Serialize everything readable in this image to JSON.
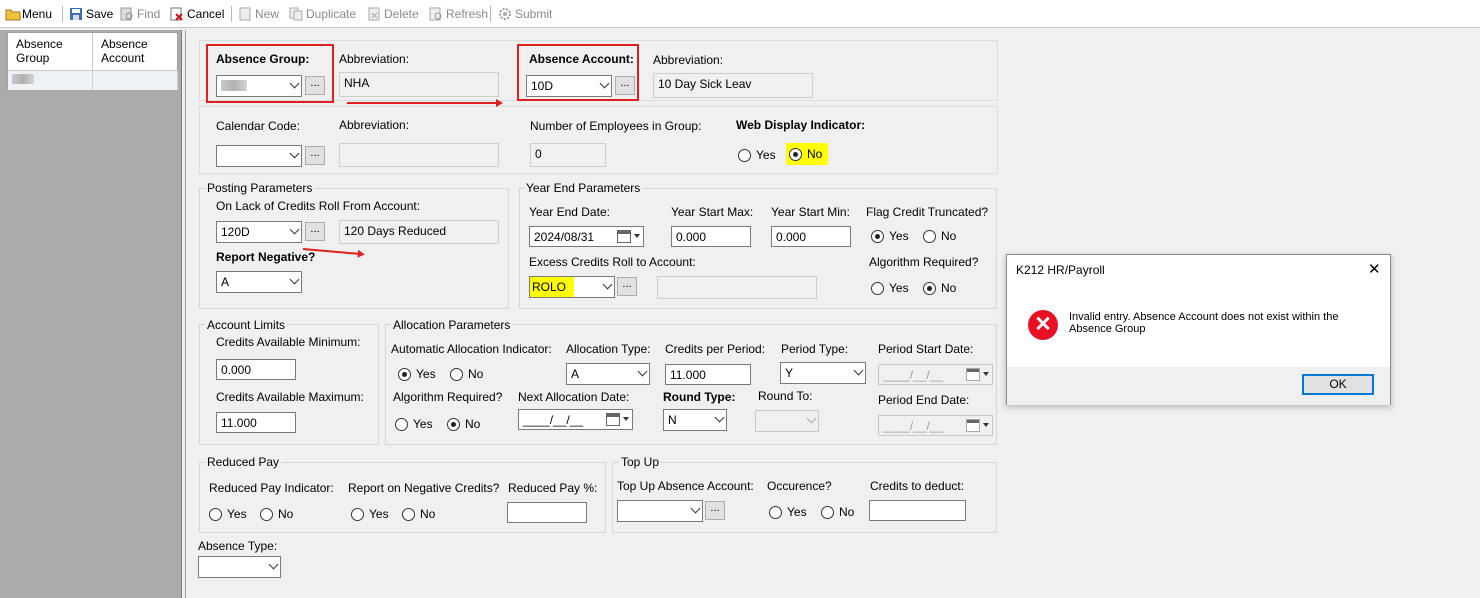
{
  "toolbar": {
    "menu": "Menu",
    "save": "Save",
    "find": "Find",
    "cancel": "Cancel",
    "new": "New",
    "duplicate": "Duplicate",
    "delete": "Delete",
    "refresh": "Refresh",
    "submit": "Submit"
  },
  "grid": {
    "col1": "Absence Group",
    "col2": "Absence Account"
  },
  "form": {
    "absence_group": {
      "label": "Absence Group:",
      "ellipsis": "..."
    },
    "abbrev1": {
      "label": "Abbreviation:",
      "value": "NHA"
    },
    "absence_account": {
      "label": "Absence Account:",
      "value": "10D",
      "ellipsis": "..."
    },
    "abbrev2": {
      "label": "Abbreviation:",
      "value": "10 Day Sick Leav"
    },
    "calendar_code": {
      "label": "Calendar Code:",
      "ellipsis": "..."
    },
    "abbrev3": {
      "label": "Abbreviation:"
    },
    "num_employees": {
      "label": "Number of Employees in Group:",
      "value": "0"
    },
    "web_display": {
      "label": "Web Display Indicator:",
      "yes": "Yes",
      "no": "No",
      "selected": "No"
    },
    "posting": {
      "title": "Posting Parameters",
      "roll_label": "On Lack of Credits Roll From Account:",
      "roll_value": "120D",
      "ellipsis": "...",
      "roll_desc": "120 Days Reduced",
      "report_negative_label": "Report Negative?",
      "report_negative_value": "A"
    },
    "year_end": {
      "title": "Year End Parameters",
      "date_label": "Year End Date:",
      "date_value": "2024/08/31",
      "start_max_label": "Year Start Max:",
      "start_max_value": "0.000",
      "start_min_label": "Year Start Min:",
      "start_min_value": "0.000",
      "flag_label": "Flag Credit Truncated?",
      "flag_yes": "Yes",
      "flag_no": "No",
      "excess_label": "Excess Credits Roll to Account:",
      "excess_value": "ROLO",
      "ellipsis": "...",
      "alg_label": "Algorithm Required?",
      "alg_yes": "Yes",
      "alg_no": "No"
    },
    "limits": {
      "title": "Account Limits",
      "min_label": "Credits Available Minimum:",
      "min_value": "0.000",
      "max_label": "Credits Available Maximum:",
      "max_value": "11.000"
    },
    "allocation": {
      "title": "Allocation Parameters",
      "auto_label": "Automatic Allocation Indicator:",
      "auto_yes": "Yes",
      "auto_no": "No",
      "type_label": "Allocation Type:",
      "type_value": "A",
      "cpp_label": "Credits per Period:",
      "cpp_value": "11.000",
      "ptype_label": "Period Type:",
      "ptype_value": "Y",
      "pstart_label": "Period Start Date:",
      "pstart_value": "____/__/__",
      "alg_label": "Algorithm Required?",
      "alg_yes": "Yes",
      "alg_no": "No",
      "next_label": "Next Allocation Date:",
      "next_value": "____/__/__",
      "round_type_label": "Round Type:",
      "round_type_value": "N",
      "round_to_label": "Round To:",
      "pend_label": "Period End Date:",
      "pend_value": "____/__/__"
    },
    "reduced": {
      "title": "Reduced Pay",
      "ind_label": "Reduced Pay Indicator:",
      "ind_yes": "Yes",
      "ind_no": "No",
      "neg_label": "Report on Negative Credits?",
      "neg_yes": "Yes",
      "neg_no": "No",
      "pct_label": "Reduced Pay %:"
    },
    "topup": {
      "title": "Top Up",
      "acct_label": "Top Up Absence Account:",
      "ellipsis": "...",
      "occ_label": "Occurence?",
      "occ_yes": "Yes",
      "occ_no": "No",
      "deduct_label": "Credits to deduct:"
    },
    "absence_type": {
      "label": "Absence Type:"
    }
  },
  "dialog": {
    "title": "K212 HR/Payroll",
    "close": "✕",
    "message": "Invalid entry. Absence Account does not exist within the Absence Group",
    "ok": "OK",
    "icon": "✕"
  },
  "colors": {
    "highlight": "#ffff00",
    "annotation": "#e02020",
    "error": "#e81123"
  }
}
